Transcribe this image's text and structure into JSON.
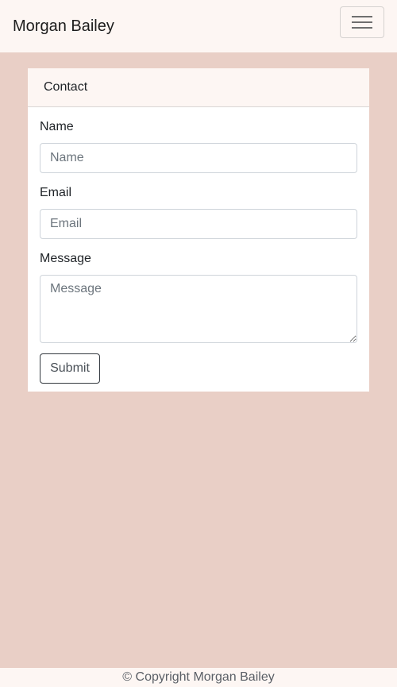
{
  "navbar": {
    "brand": "Morgan Bailey",
    "toggler_icon": "hamburger-menu-icon"
  },
  "contact_card": {
    "header": "Contact",
    "name": {
      "label": "Name",
      "placeholder": "Name",
      "value": ""
    },
    "email": {
      "label": "Email",
      "placeholder": "Email",
      "value": ""
    },
    "message": {
      "label": "Message",
      "placeholder": "Message",
      "value": ""
    },
    "submit_label": "Submit"
  },
  "footer": {
    "copyright": "© Copyright Morgan Bailey"
  },
  "colors": {
    "page_background": "#e9cfc6",
    "navbar_background": "#fdf6f3",
    "card_background": "#ffffff",
    "submit_border": "#343a40"
  }
}
